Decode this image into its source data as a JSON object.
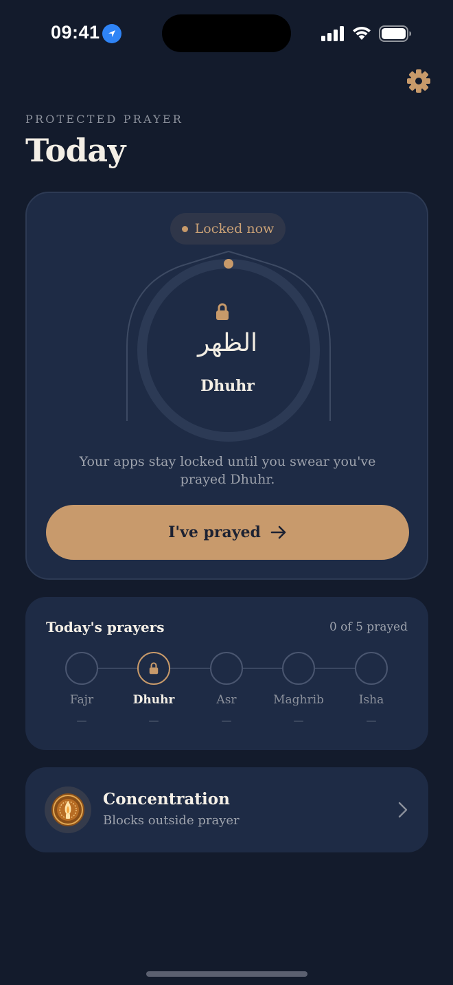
{
  "status_bar": {
    "time": "09:41"
  },
  "header": {
    "eyebrow": "PROTECTED PRAYER",
    "title": "Today"
  },
  "lock_card": {
    "status_pill": "Locked now",
    "prayer_arabic": "الظهر",
    "prayer_name": "Dhuhr",
    "message": "Your apps stay locked until you swear you've prayed Dhuhr.",
    "button_label": "I've prayed"
  },
  "prayers": {
    "title": "Today's prayers",
    "count_text": "0 of 5 prayed",
    "items": [
      {
        "name": "Fajr",
        "time": "—",
        "active": false
      },
      {
        "name": "Dhuhr",
        "time": "—",
        "active": true
      },
      {
        "name": "Asr",
        "time": "—",
        "active": false
      },
      {
        "name": "Maghrib",
        "time": "—",
        "active": false
      },
      {
        "name": "Isha",
        "time": "—",
        "active": false
      }
    ]
  },
  "concentration": {
    "title": "Concentration",
    "subtitle": "Blocks outside prayer"
  },
  "colors": {
    "background": "#131b2c",
    "card": "#1e2b45",
    "accent": "#c89a6c"
  },
  "icons": [
    "location-icon",
    "signal-icon",
    "wifi-icon",
    "battery-icon",
    "gear-icon",
    "lock-icon",
    "arrow-right-icon",
    "candle-icon",
    "chevron-right-icon"
  ]
}
